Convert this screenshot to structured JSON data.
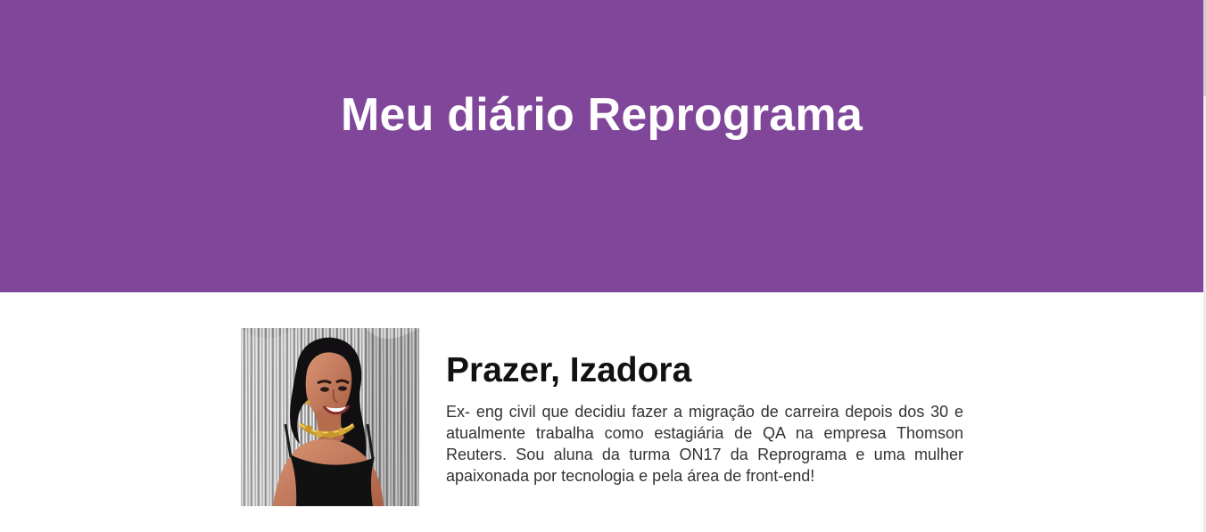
{
  "colors": {
    "hero_background": "#80469a",
    "hero_text": "#ffffff",
    "heading_text": "#111111",
    "body_text": "#333333",
    "page_background": "#ffffff"
  },
  "hero": {
    "title": "Meu diário Reprograma"
  },
  "profile": {
    "photo_icon": "profile-photo",
    "heading": "Prazer, Izadora",
    "bio": "Ex- eng civil que decidiu fazer a migração de carreira depois dos 30 e atualmente trabalha como estagiária de QA na empresa Thomson Reuters. Sou aluna da turma ON17 da Reprograma e uma mulher apaixonada por tecnologia e pela área de front-end!"
  }
}
